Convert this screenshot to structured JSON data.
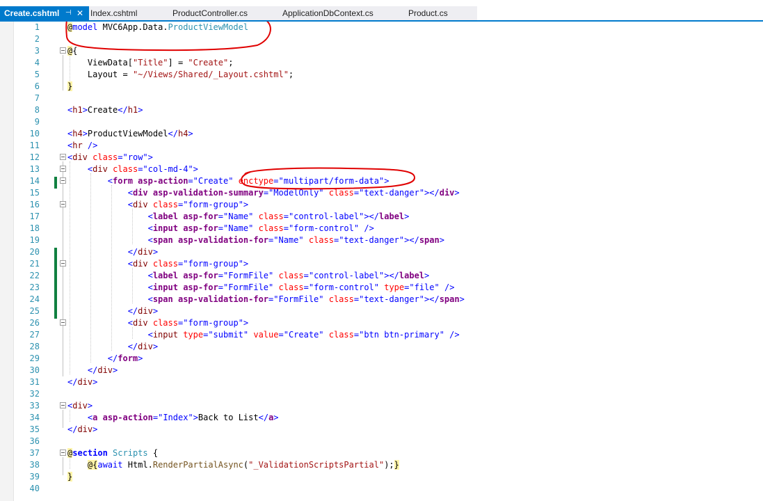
{
  "tabs": [
    {
      "label": "Create.cshtml",
      "active": true
    },
    {
      "label": "Index.cshtml"
    },
    {
      "label": "ProductController.cs"
    },
    {
      "label": "ApplicationDbContext.cs"
    },
    {
      "label": "Product.cs"
    }
  ],
  "tab_icons": {
    "pin": "pin-icon",
    "close": "close-icon"
  },
  "line_numbers": [
    "1",
    "2",
    "3",
    "4",
    "5",
    "6",
    "7",
    "8",
    "9",
    "10",
    "11",
    "12",
    "13",
    "14",
    "15",
    "16",
    "17",
    "18",
    "19",
    "20",
    "21",
    "22",
    "23",
    "24",
    "25",
    "26",
    "27",
    "28",
    "29",
    "30",
    "31",
    "32",
    "33",
    "34",
    "35",
    "36",
    "37",
    "38",
    "39",
    "40"
  ],
  "code": {
    "l1": {
      "kw": "model",
      "ns": "MVC6App.Data.",
      "type": "ProductViewModel"
    },
    "l3": {
      "open": "{"
    },
    "l4": {
      "name": "ViewData",
      "key": "\"Title\"",
      "value": "\"Create\"",
      "end": ";"
    },
    "l5": {
      "name": "Layout",
      "value": "\"~/Views/Shared/_Layout.cshtml\"",
      "end": ";"
    },
    "l6": {
      "close": "}"
    },
    "l8": {
      "tag": "h1",
      "text": "Create"
    },
    "l10": {
      "tag": "h4",
      "text": "ProductViewModel"
    },
    "l11": {
      "tag": "hr"
    },
    "l12": {
      "tag": "div",
      "attr": "class",
      "value": "\"row\""
    },
    "l13": {
      "tag": "div",
      "attr": "class",
      "value": "\"col-md-4\""
    },
    "l14": {
      "tag": "form",
      "attr1": "asp-action",
      "val1": "\"Create\"",
      "attr2": "enctype",
      "val2": "\"multipart/form-data\""
    },
    "l15": {
      "tag": "div",
      "attr1": "asp-validation-summary",
      "val1": "\"ModelOnly\"",
      "attr2": "class",
      "val2": "\"text-danger\""
    },
    "l16": {
      "tag": "div",
      "attr": "class",
      "value": "\"form-group\""
    },
    "l17": {
      "tag": "label",
      "attr1": "asp-for",
      "val1": "\"Name\"",
      "attr2": "class",
      "val2": "\"control-label\""
    },
    "l18": {
      "tag": "input",
      "attr1": "asp-for",
      "val1": "\"Name\"",
      "attr2": "class",
      "val2": "\"form-control\""
    },
    "l19": {
      "tag": "span",
      "attr1": "asp-validation-for",
      "val1": "\"Name\"",
      "attr2": "class",
      "val2": "\"text-danger\""
    },
    "l20": {
      "tag": "div"
    },
    "l21": {
      "tag": "div",
      "attr": "class",
      "value": "\"form-group\""
    },
    "l22": {
      "tag": "label",
      "attr1": "asp-for",
      "val1": "\"FormFile\"",
      "attr2": "class",
      "val2": "\"control-label\""
    },
    "l23": {
      "tag": "input",
      "attr1": "asp-for",
      "val1": "\"FormFile\"",
      "attr2": "class",
      "val2": "\"form-control\"",
      "attr3": "type",
      "val3": "\"file\""
    },
    "l24": {
      "tag": "span",
      "attr1": "asp-validation-for",
      "val1": "\"FormFile\"",
      "attr2": "class",
      "val2": "\"text-danger\""
    },
    "l25": {
      "tag": "div"
    },
    "l26": {
      "tag": "div",
      "attr": "class",
      "value": "\"form-group\""
    },
    "l27": {
      "tag": "input",
      "attr1": "type",
      "val1": "\"submit\"",
      "attr2": "value",
      "val2": "\"Create\"",
      "attr3": "class",
      "val3": "\"btn btn-primary\""
    },
    "l28": {
      "tag": "div"
    },
    "l29": {
      "tag": "form"
    },
    "l30": {
      "tag": "div"
    },
    "l31": {
      "tag": "div"
    },
    "l33": {
      "tag": "div"
    },
    "l34": {
      "tag": "a",
      "attr": "asp-action",
      "value": "\"Index\"",
      "text": "Back to List",
      "close": "a"
    },
    "l35": {
      "tag": "div"
    },
    "l37": {
      "kw": "section",
      "name": "Scripts",
      "open": "{"
    },
    "l38": {
      "kw": "await",
      "obj": "Html.",
      "method": "RenderPartialAsync",
      "arg": "\"_ValidationScriptsPartial\"",
      "end": ");"
    },
    "l39": {
      "close": "}"
    }
  },
  "colors": {
    "tab_active": "#007acc",
    "line_number": "#2b91af",
    "change_bar": "#108040",
    "annotation": "#e00000"
  }
}
